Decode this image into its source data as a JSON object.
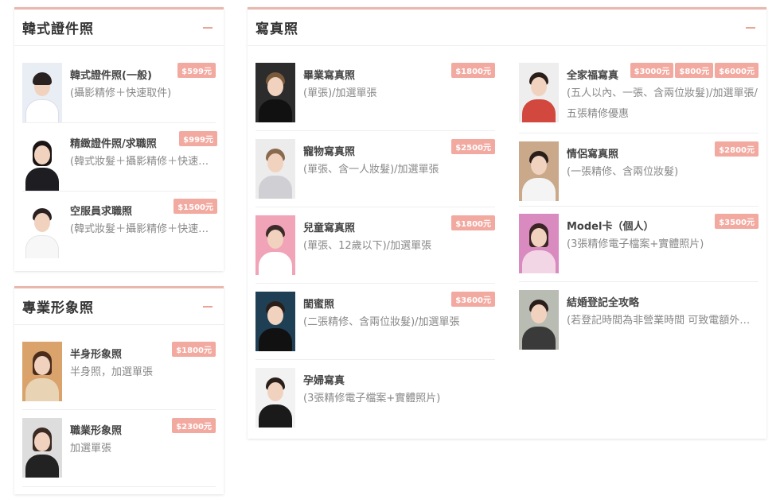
{
  "left_top_panel": {
    "title": "韓式證件照",
    "items": [
      {
        "name": "韓式證件照(一般)",
        "desc": "(攝影精修＋快速取件)",
        "prices": [
          "$599元"
        ],
        "icon": "portrait-male-photo"
      },
      {
        "name": "精緻證件照/求職照",
        "desc": "(韓式妝髮＋攝影精修＋快速取件)",
        "prices": [
          "$999元"
        ],
        "icon": "portrait-female-photo"
      },
      {
        "name": "空服員求職照",
        "desc": "(韓式妝髮＋攝影精修＋快速取件)",
        "prices": [
          "$1500元"
        ],
        "icon": "portrait-female-photo"
      }
    ]
  },
  "left_bottom_panel": {
    "title": "專業形象照",
    "items": [
      {
        "name": "半身形象照",
        "desc": "半身照，加選單張",
        "prices": [
          "$1800元"
        ],
        "icon": "half-body-photo"
      },
      {
        "name": "職業形象照",
        "desc": "加選單張",
        "prices": [
          "$2300元"
        ],
        "icon": "business-photo"
      }
    ]
  },
  "main_panel": {
    "title": "寫真照",
    "col1": [
      {
        "name": "畢業寫真照",
        "desc": "(單張)/加選單張",
        "prices": [
          "$1800元"
        ]
      },
      {
        "name": "寵物寫真照",
        "desc": "(單張、含一人妝髮)/加選單張",
        "prices": [
          "$2500元"
        ]
      },
      {
        "name": "兒童寫真照",
        "desc": "(單張、12歲以下)/加選單張",
        "prices": [
          "$1800元"
        ]
      },
      {
        "name": "閨蜜照",
        "desc": "(二張精修、含兩位妝髮)/加選單張",
        "prices": [
          "$3600元"
        ]
      },
      {
        "name": "孕婦寫真",
        "desc": "(3張精修電子檔案+實體照片)",
        "prices": []
      }
    ],
    "col2": [
      {
        "name": "全家福寫真",
        "desc": "(五人以內、一張、含兩位妝髮)/加選單張/五張精修優惠",
        "prices": [
          "$3000元",
          "$800元",
          "$6000元"
        ]
      },
      {
        "name": "情侶寫真照",
        "desc": "(一張精修、含兩位妝髮)",
        "prices": [
          "$2800元"
        ]
      },
      {
        "name": "Model卡（個人）",
        "desc": "(3張精修電子檔案+實體照片)",
        "prices": [
          "$3500元"
        ]
      },
      {
        "name": "結婚登記全攻略",
        "desc": "(若登記時間為非營業時間 可致電額外預約)",
        "prices": []
      }
    ]
  },
  "colors": {
    "accent": "#e8b7ad",
    "price_badge": "#f2a9a0"
  }
}
